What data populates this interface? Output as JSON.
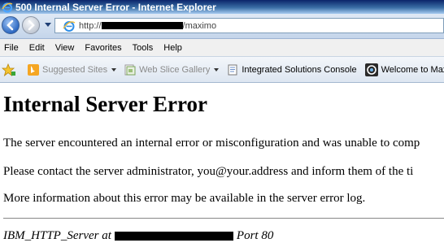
{
  "window": {
    "title": "500 Internal Server Error - Internet Explorer"
  },
  "address_bar": {
    "url_prefix": "http://",
    "url_suffix": "/maximo"
  },
  "menu": [
    "File",
    "Edit",
    "View",
    "Favorites",
    "Tools",
    "Help"
  ],
  "favorites_bar": {
    "items": [
      {
        "label": "Suggested Sites",
        "icon": "bing-icon",
        "dropdown": true,
        "dimmed": true
      },
      {
        "label": "Web Slice Gallery",
        "icon": "web-slice-icon",
        "dropdown": true,
        "dimmed": true
      },
      {
        "label": "Integrated Solutions Console",
        "icon": "page-icon",
        "dropdown": false,
        "dimmed": false
      },
      {
        "label": "Welcome to Maximo",
        "icon": "maximo-icon",
        "dropdown": false,
        "dimmed": false
      }
    ]
  },
  "page": {
    "heading": "Internal Server Error",
    "paragraph1": "The server encountered an internal error or misconfiguration and was unable to comp",
    "paragraph2": "Please contact the server administrator, you@your.address and inform them of the ti",
    "paragraph3": "More information about this error may be available in the server error log.",
    "footer_prefix": "IBM_HTTP_Server at",
    "footer_suffix": "Port 80"
  },
  "colors": {
    "titlebar": "#0a246a",
    "text": "#000000",
    "redaction": "#000000"
  }
}
